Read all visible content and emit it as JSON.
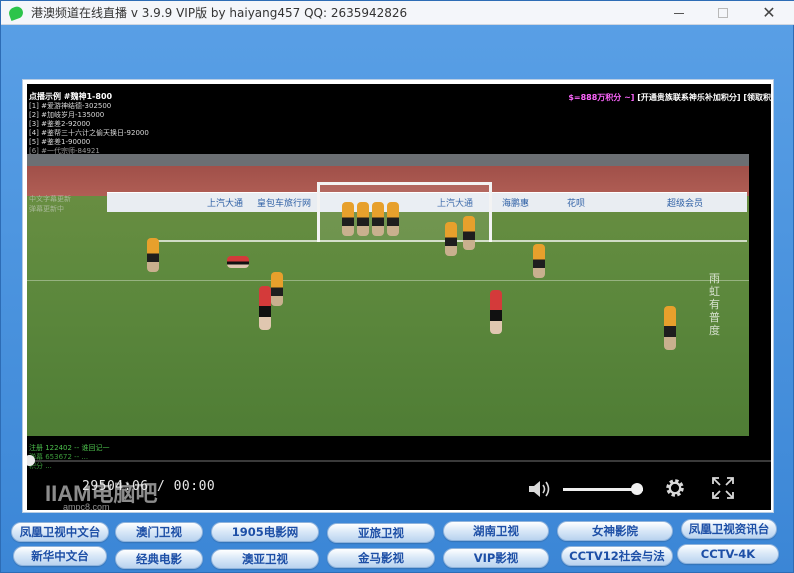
{
  "window": {
    "title": "港澳频道在线直播 v 3.9.9   VIP版   by haiyang457   QQ:  2635942826"
  },
  "video": {
    "overlay_title": "点播示例 #魏神1-800",
    "overlay_lines": [
      "[1] #爱游神结德-302500",
      "[2] #加岐岁月-135000",
      "[3] #鉴差2-92000",
      "[4] #鉴帮三十六计之偷天换日-92000",
      "[5] #鉴差1-90000",
      "[6] #一代宗师-84921"
    ],
    "overlay_right_prefix": "",
    "overlay_right_hl": "$=888万积分 ~]",
    "overlay_right_rest": " [开通贵族联系神乐补加积分] [领取积",
    "vertical_watermark": "雨虹有普度",
    "ad_texts": [
      "上汽大通",
      "皇包车旅行网",
      "上汽大通",
      "海鹏惠",
      "花呗",
      "超级会员"
    ],
    "danmaku_lines": [
      "中文字幕更新",
      "弹幕更新中"
    ],
    "bottom_danmaku_1": "注册 122402 -- 谁回记一",
    "bottom_danmaku_2": "弹幕 653672 -- ...",
    "bottom_danmaku_3": "积分 ...",
    "time": "29504:06 / 00:00",
    "site_watermark": "IIAM电脑吧",
    "site_watermark_sub": "ampc8.com",
    "volume_level": 0.92
  },
  "channels": {
    "row1": [
      "凤凰卫视中文台",
      "澳门卫视",
      "1905电影网",
      "亚旅卫视",
      "湖南卫视",
      "女神影院",
      "凤凰卫视资讯台"
    ],
    "row2": [
      "新华中文台",
      "经典电影",
      "澳亚卫视",
      "金马影视",
      "VIP影视",
      "CCTV12社会与法",
      "CCTV-4K"
    ]
  }
}
